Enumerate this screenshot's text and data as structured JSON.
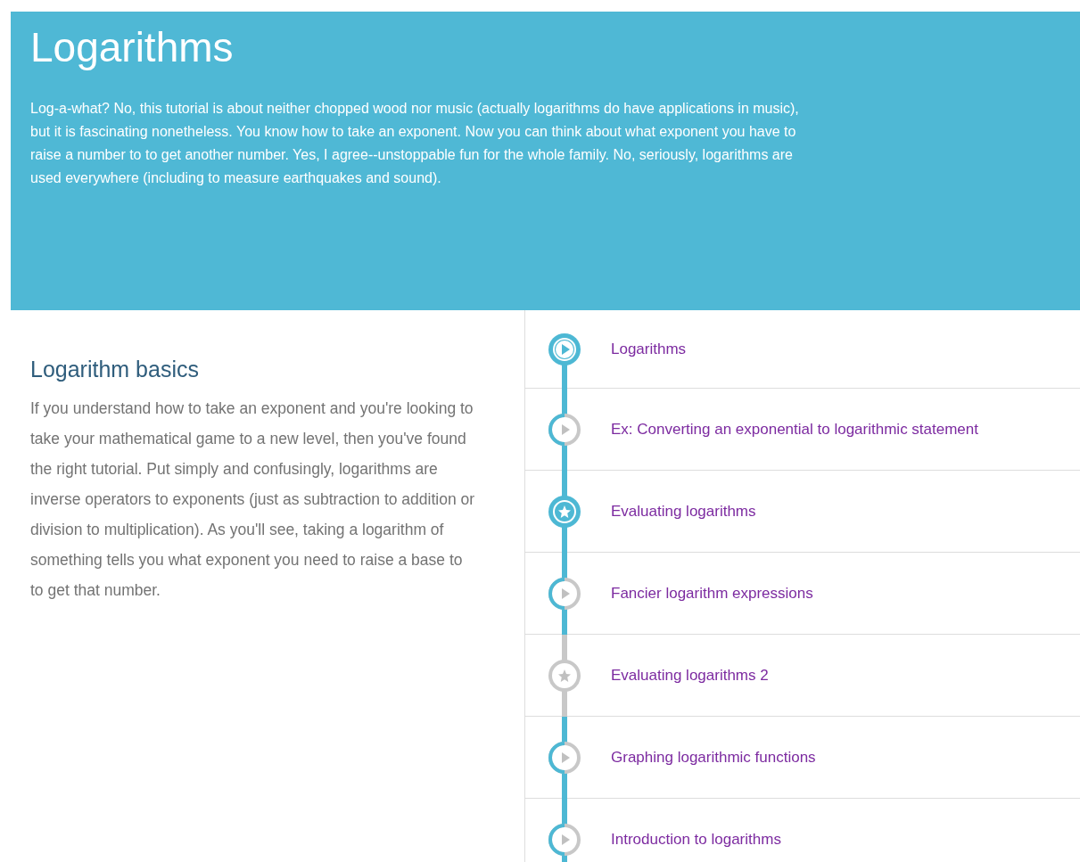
{
  "header": {
    "title": "Logarithms",
    "description": "Log-a-what? No, this tutorial is about neither chopped wood nor music (actually logarithms do have applications in music), but it is fascinating nonetheless. You know how to take an exponent. Now you can think about what exponent you have to raise a number to to get another number. Yes, I agree--unstoppable fun for the whole family. No, seriously, logarithms are used everywhere (including to measure earthquakes and sound)."
  },
  "section": {
    "title": "Logarithm basics",
    "description": "If you understand how to take an exponent and you're looking to take your mathematical game to a new level, then you've found the right tutorial. Put simply and confusingly, logarithms are inverse operators to exponents (just as subtraction to addition or division to multiplication). As you'll see, taking a logarithm of something tells you what exponent you need to raise a base to to get that number."
  },
  "items": [
    {
      "kind": "video",
      "title": "Logarithms",
      "started": true,
      "completed": true
    },
    {
      "kind": "video",
      "title": "Ex: Converting an exponential to logarithmic statement",
      "started": true,
      "completed": false
    },
    {
      "kind": "exercise",
      "title": "Evaluating logarithms",
      "started": true,
      "completed": true
    },
    {
      "kind": "video",
      "title": "Fancier logarithm expressions",
      "started": true,
      "completed": false
    },
    {
      "kind": "exercise",
      "title": "Evaluating logarithms 2",
      "started": false,
      "completed": false
    },
    {
      "kind": "video",
      "title": "Graphing logarithmic functions",
      "started": true,
      "completed": false
    },
    {
      "kind": "video",
      "title": "Introduction to logarithms",
      "started": true,
      "completed": false
    }
  ]
}
